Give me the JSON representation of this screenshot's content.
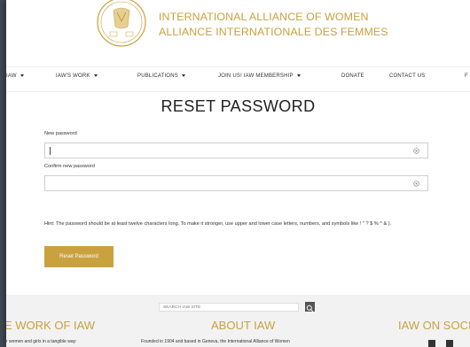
{
  "header": {
    "line1": "INTERNATIONAL ALLIANCE OF WOMEN",
    "line2": "ALLIANCE INTERNATIONALE DES FEMMES",
    "accent": "#c9a13f"
  },
  "nav": {
    "items": [
      "IAW",
      "IAW'S WORK",
      "PUBLICATIONS",
      "JOIN US! IAW MEMBERSHIP",
      "DONATE",
      "CONTACT US",
      "F"
    ]
  },
  "form": {
    "title": "RESET PASSWORD",
    "new_label": "New password",
    "new_value": "",
    "confirm_label": "Confirm new password",
    "confirm_value": "",
    "hint": "Hint: The password should be at least twelve characters long. To make it stronger, use upper and lower case letters, numbers, and symbols like ! \" ? $ % ^ & ).",
    "button_label": "Reset Password",
    "icons": [
      "eye-icon",
      "eye-icon"
    ]
  },
  "footer": {
    "search_placeholder": "SEARCH IAW SITE",
    "col1_title": "E WORK OF IAW",
    "col1_text": "r women and girls in a tangible way:",
    "col2_title": "ABOUT IAW",
    "col2_text": "Founded in 1904 and based in Geneva, the International Alliance of Women",
    "col3_title": "IAW ON SOCI",
    "social_icons": [
      "facebook-icon",
      "youtube-icon"
    ],
    "bg": "#3f4a54"
  }
}
